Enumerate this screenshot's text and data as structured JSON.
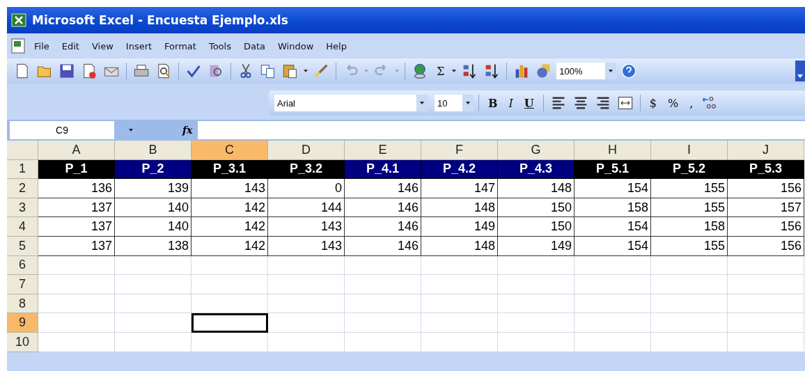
{
  "window": {
    "title": "Microsoft Excel - Encuesta Ejemplo.xls"
  },
  "menu": [
    "File",
    "Edit",
    "View",
    "Insert",
    "Format",
    "Tools",
    "Data",
    "Window",
    "Help"
  ],
  "toolbar": {
    "sum": "Σ",
    "zoom": "100%"
  },
  "formatting": {
    "font": "Arial",
    "size": "10",
    "bold": "B",
    "italic": "I",
    "underline": "U",
    "currency": "$",
    "percent": "%",
    "comma": ","
  },
  "formula_bar": {
    "name_box": "C9",
    "function_label": "fx"
  },
  "columns": [
    {
      "label": "A",
      "selected": false
    },
    {
      "label": "B",
      "selected": false
    },
    {
      "label": "C",
      "selected": true
    },
    {
      "label": "D",
      "selected": false
    },
    {
      "label": "E",
      "selected": false
    },
    {
      "label": "F",
      "selected": false
    },
    {
      "label": "G",
      "selected": false
    },
    {
      "label": "H",
      "selected": false
    },
    {
      "label": "I",
      "selected": false
    },
    {
      "label": "J",
      "selected": false
    }
  ],
  "rows": [
    {
      "number": "1",
      "selected": false,
      "kind": "header",
      "cells": [
        {
          "text": "P_1",
          "color": "#000000"
        },
        {
          "text": "P_2",
          "color": "#000080"
        },
        {
          "text": "P_3.1",
          "color": "#000000"
        },
        {
          "text": "P_3.2",
          "color": "#000000"
        },
        {
          "text": "P_4.1",
          "color": "#000080"
        },
        {
          "text": "P_4.2",
          "color": "#000080"
        },
        {
          "text": "P_4.3",
          "color": "#000080"
        },
        {
          "text": "P_5.1",
          "color": "#000000"
        },
        {
          "text": "P_5.2",
          "color": "#000000"
        },
        {
          "text": "P_5.3",
          "color": "#000000"
        }
      ]
    },
    {
      "number": "2",
      "selected": false,
      "kind": "data",
      "cells": [
        "136",
        "139",
        "143",
        "0",
        "146",
        "147",
        "148",
        "154",
        "155",
        "156"
      ]
    },
    {
      "number": "3",
      "selected": false,
      "kind": "data",
      "cells": [
        "137",
        "140",
        "142",
        "144",
        "146",
        "148",
        "150",
        "158",
        "155",
        "157"
      ]
    },
    {
      "number": "4",
      "selected": false,
      "kind": "data",
      "cells": [
        "137",
        "140",
        "142",
        "143",
        "146",
        "149",
        "150",
        "154",
        "158",
        "156"
      ]
    },
    {
      "number": "5",
      "selected": false,
      "kind": "data",
      "cells": [
        "137",
        "138",
        "142",
        "143",
        "146",
        "148",
        "149",
        "154",
        "155",
        "156"
      ]
    },
    {
      "number": "6",
      "selected": false,
      "kind": "empty"
    },
    {
      "number": "7",
      "selected": false,
      "kind": "empty"
    },
    {
      "number": "8",
      "selected": false,
      "kind": "empty"
    },
    {
      "number": "9",
      "selected": true,
      "kind": "empty"
    },
    {
      "number": "10",
      "selected": false,
      "kind": "empty"
    }
  ]
}
